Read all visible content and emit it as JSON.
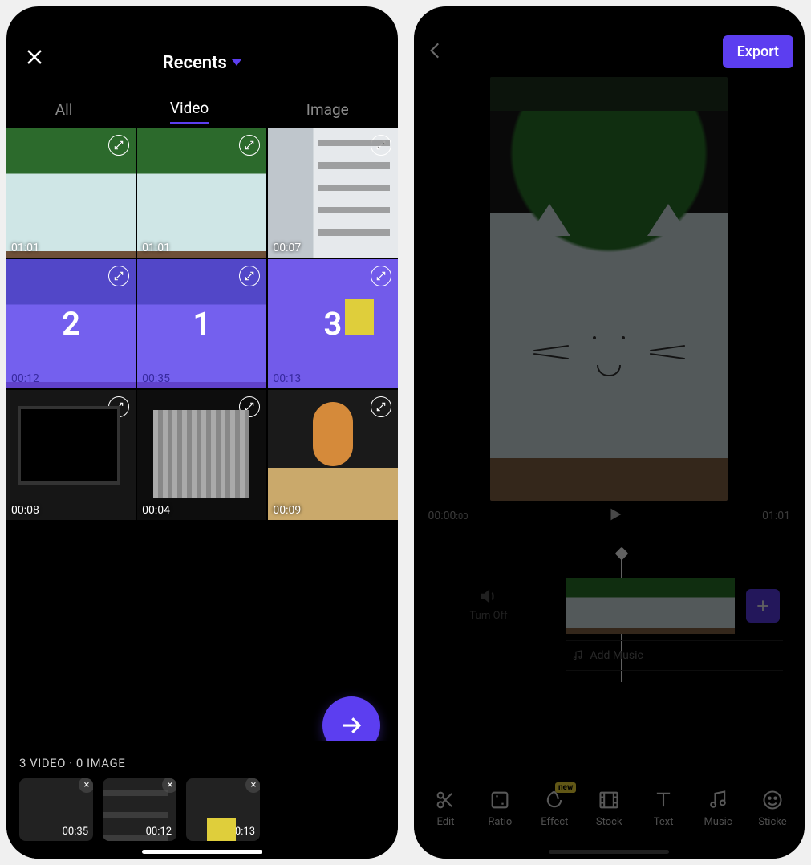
{
  "accent": "#5c3ef0",
  "picker": {
    "album_label": "Recents",
    "tabs": {
      "all": "All",
      "video": "Video",
      "image": "Image",
      "active": "video"
    },
    "grid": [
      {
        "duration": "01:01",
        "thumb": "plant",
        "selected": false
      },
      {
        "duration": "01:01",
        "thumb": "plant",
        "selected": false
      },
      {
        "duration": "00:07",
        "thumb": "words",
        "selected": false
      },
      {
        "duration": "00:12",
        "thumb": "plant",
        "selected": true,
        "order": "2"
      },
      {
        "duration": "00:35",
        "thumb": "plant",
        "selected": true,
        "order": "1"
      },
      {
        "duration": "00:13",
        "thumb": "office",
        "selected": true,
        "order": "3"
      },
      {
        "duration": "00:08",
        "thumb": "monitor",
        "selected": false
      },
      {
        "duration": "00:04",
        "thumb": "blinds",
        "selected": false
      },
      {
        "duration": "00:09",
        "thumb": "cat",
        "selected": false
      }
    ],
    "tray_count": "3 VIDEO · 0 IMAGE",
    "tray": [
      {
        "duration": "00:35",
        "thumb": "plant"
      },
      {
        "duration": "00:12",
        "thumb": "words"
      },
      {
        "duration": "00:13",
        "thumb": "office"
      }
    ]
  },
  "editor": {
    "export_label": "Export",
    "time_current": "00:00",
    "time_current_ms": ":00",
    "time_total": "01:01",
    "sound_label": "Turn Off",
    "add_music_label": "Add Music",
    "effect_tag": "new",
    "toolbar": {
      "edit": "Edit",
      "ratio": "Ratio",
      "effect": "Effect",
      "stock": "Stock",
      "text": "Text",
      "music": "Music",
      "sticker": "Sticke"
    }
  }
}
